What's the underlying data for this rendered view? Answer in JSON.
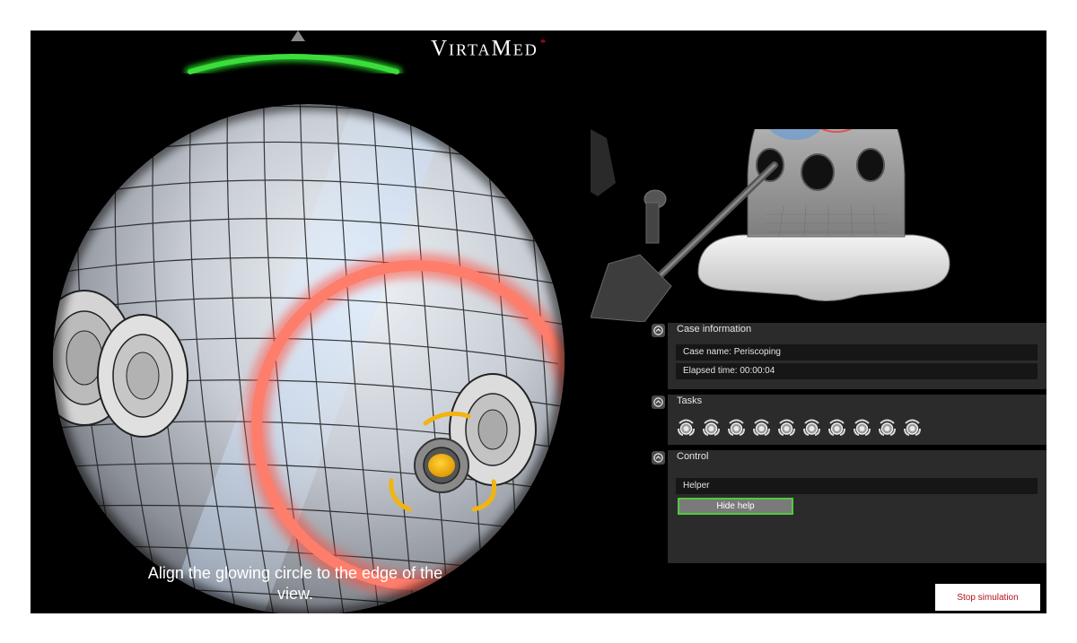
{
  "brand": {
    "name": "VirtaMed",
    "mark": "*"
  },
  "instruction": "Align the glowing circle to the edge of the view.",
  "panels": {
    "case_information": {
      "title": "Case information",
      "case_name": "Case name: Periscoping",
      "elapsed_time": "Elapsed time: 00:00:04"
    },
    "tasks": {
      "title": "Tasks",
      "items": [
        {
          "icon": "task-target-icon"
        },
        {
          "icon": "task-target-icon"
        },
        {
          "icon": "task-target-icon"
        },
        {
          "icon": "task-target-icon"
        },
        {
          "icon": "task-target-icon"
        },
        {
          "icon": "task-target-icon"
        },
        {
          "icon": "task-target-icon"
        },
        {
          "icon": "task-target-icon"
        },
        {
          "icon": "task-target-icon"
        },
        {
          "icon": "task-target-icon"
        }
      ]
    },
    "control": {
      "title": "Control",
      "helper_label": "Helper",
      "hide_help_label": "Hide help"
    }
  },
  "stop_button_label": "Stop simulation",
  "colors": {
    "accent_green": "#4fcd3a",
    "glow_ring": "#ff6f5e",
    "target_gold": "#f3b10b",
    "stop_text": "#b0141b",
    "brand_star": "#d1182b"
  }
}
